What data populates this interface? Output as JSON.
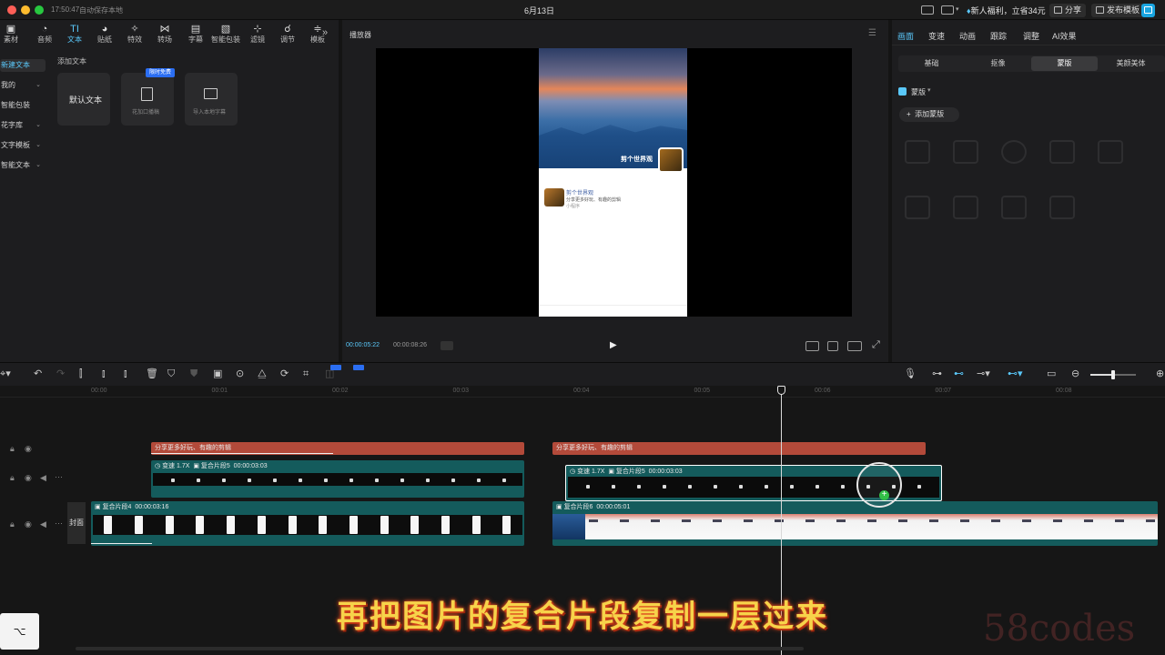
{
  "titlebar": {
    "time": "17:50:47",
    "autosave": "自动保存本地",
    "date": "6月13日",
    "promo": "新人福利，立省34元",
    "share": "分享",
    "publish_template": "发布模板"
  },
  "toolbar_top": [
    {
      "id": "media",
      "label": "素材",
      "icon": "▣"
    },
    {
      "id": "audio",
      "label": "音频",
      "icon": "◔"
    },
    {
      "id": "text",
      "label": "文本",
      "icon": "TI"
    },
    {
      "id": "sticker",
      "label": "贴纸",
      "icon": "◕"
    },
    {
      "id": "effects",
      "label": "特效",
      "icon": "✧"
    },
    {
      "id": "transition",
      "label": "转场",
      "icon": "⋈"
    },
    {
      "id": "subtitle",
      "label": "字幕",
      "icon": "▤"
    },
    {
      "id": "smart-pack",
      "label": "智能包装",
      "icon": "▧"
    },
    {
      "id": "filter",
      "label": "滤镜",
      "icon": "⊹"
    },
    {
      "id": "adjust",
      "label": "调节",
      "icon": "☌"
    },
    {
      "id": "template",
      "label": "模板",
      "icon": "≑"
    }
  ],
  "text_sidebar": [
    {
      "label": "新建文本",
      "selected": true,
      "caret": false
    },
    {
      "label": "我的",
      "selected": false,
      "caret": true
    },
    {
      "label": "智能包装",
      "selected": false,
      "caret": false
    },
    {
      "label": "花字库",
      "selected": false,
      "caret": true
    },
    {
      "label": "文字模板",
      "selected": false,
      "caret": true
    },
    {
      "label": "智能文本",
      "selected": false,
      "caret": true
    }
  ],
  "text_panel": {
    "heading": "添加文本",
    "default_text": "默认文本",
    "add_subtitle": "花加口播稿",
    "add_subtitle_badge": "限时免费",
    "import_subtitle": "导入本地字幕"
  },
  "player": {
    "title": "播放器",
    "current_time": "00:00:05:22",
    "total_time": "00:00:08:26",
    "video_channel": "剪个世界观",
    "card_name": "剪个世界观",
    "card_line": "分享更多好玩、有趣的剪辑",
    "card_sub": "小程序"
  },
  "right_panel": {
    "tabs": [
      "画面",
      "变速",
      "动画",
      "跟踪",
      "调整",
      "AI效果"
    ],
    "active_tab": "画面",
    "subtabs": [
      "基础",
      "抠像",
      "蒙版",
      "美颜美体"
    ],
    "active_subtab": "蒙版",
    "mask_label": "蒙版",
    "add_mask": "添加蒙版"
  },
  "ruler": [
    "00:00",
    "00:01",
    "00:02",
    "00:03",
    "00:04",
    "00:05",
    "00:06",
    "00:07",
    "00:08"
  ],
  "tracks": {
    "text_clip_1": "分享更多好玩、有趣的剪辑",
    "text_clip_2": "分享更多好玩、有趣的剪辑",
    "overlay_1": {
      "speed": "变速 1.7X",
      "name": "复合片段5",
      "duration": "00:00:03:03"
    },
    "overlay_2": {
      "speed": "变速 1.7X",
      "name": "复合片段5",
      "duration": "00:00:03:03"
    },
    "main_1": {
      "name": "复合片段4",
      "duration": "00:00:03:16"
    },
    "main_2": {
      "name": "复合片段6",
      "duration": "00:00:05:01"
    },
    "cover": "封面"
  },
  "caption": "再把图片的复合片段复制一层过来",
  "watermark": "58codes",
  "colors": {
    "accent": "#5ac8fa",
    "text_clip": "#b34a3a",
    "video_clip": "#145b5c",
    "caption": "#f7d34a"
  }
}
